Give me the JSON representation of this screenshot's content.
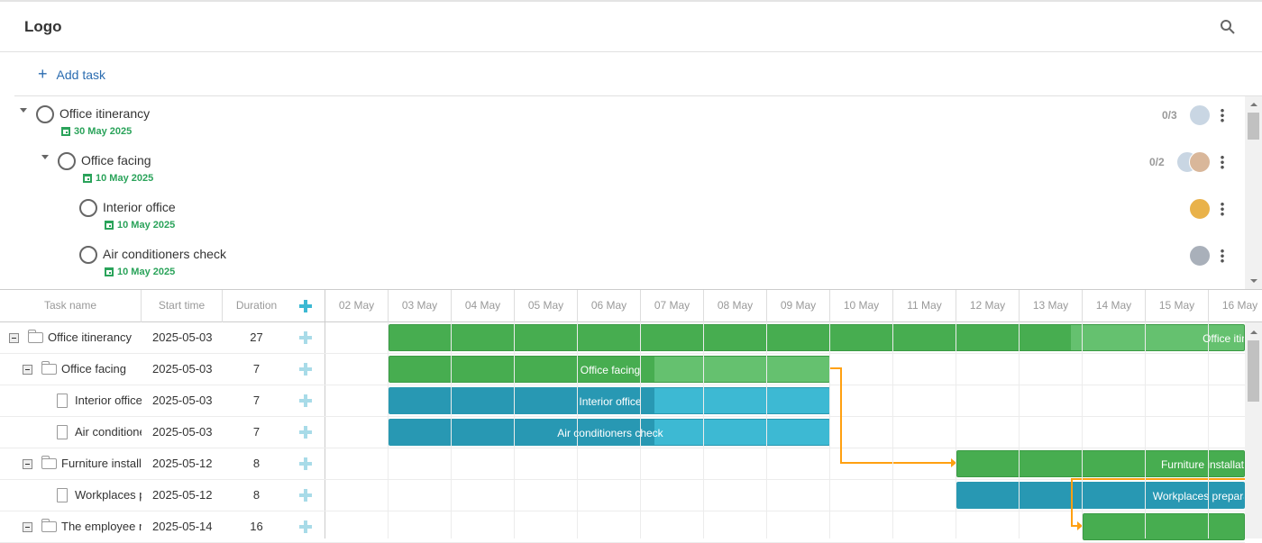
{
  "header": {
    "logo": "Logo",
    "search_icon": "search-icon"
  },
  "toolbar": {
    "add_task": "Add task"
  },
  "tasks": [
    {
      "name": "Office itinerancy",
      "date": "30 May 2025",
      "count": "0/3",
      "level": 0,
      "expanded": true
    },
    {
      "name": "Office facing",
      "date": "10 May 2025",
      "count": "0/2",
      "level": 1,
      "expanded": true
    },
    {
      "name": "Interior office",
      "date": "10 May 2025",
      "count": "",
      "level": 2
    },
    {
      "name": "Air conditioners check",
      "date": "10 May 2025",
      "count": "",
      "level": 2
    }
  ],
  "gantt": {
    "columns": {
      "name": "Task name",
      "start": "Start time",
      "duration": "Duration"
    },
    "days": [
      "02 May",
      "03 May",
      "04 May",
      "05 May",
      "06 May",
      "07 May",
      "08 May",
      "09 May",
      "10 May",
      "11 May",
      "12 May",
      "13 May",
      "14 May",
      "15 May",
      "16 May"
    ],
    "rows": [
      {
        "name": "Office itinerancy",
        "start": "2025-05-03",
        "duration": "27",
        "level": 0,
        "type": "project",
        "bar_label": "Office itinerancy",
        "progress": 0.4
      },
      {
        "name": "Office facing",
        "start": "2025-05-03",
        "duration": "7",
        "level": 1,
        "type": "project",
        "bar_label": "Office facing",
        "progress": 0.6
      },
      {
        "name": "Interior office",
        "start": "2025-05-03",
        "duration": "7",
        "level": 2,
        "type": "task",
        "bar_label": "Interior office",
        "progress": 0.6
      },
      {
        "name": "Air conditioners check",
        "start": "2025-05-03",
        "duration": "7",
        "level": 2,
        "type": "task",
        "bar_label": "Air conditioners check",
        "progress": 0.6
      },
      {
        "name": "Furniture installation",
        "start": "2025-05-12",
        "duration": "8",
        "level": 1,
        "type": "project",
        "bar_label": "Furniture installation",
        "progress": 1
      },
      {
        "name": "Workplaces preparation",
        "start": "2025-05-12",
        "duration": "8",
        "level": 2,
        "type": "task",
        "bar_label": "Workplaces preparation",
        "progress": 1
      },
      {
        "name": "The employee relocation",
        "start": "2025-05-14",
        "duration": "16",
        "level": 1,
        "type": "project",
        "bar_label": "",
        "progress": 1
      }
    ],
    "colors": {
      "project": "#65c16f",
      "project_progress": "#47ad50",
      "task": "#3db9d3",
      "task_progress": "#2898b3",
      "link": "#ffa011"
    }
  }
}
